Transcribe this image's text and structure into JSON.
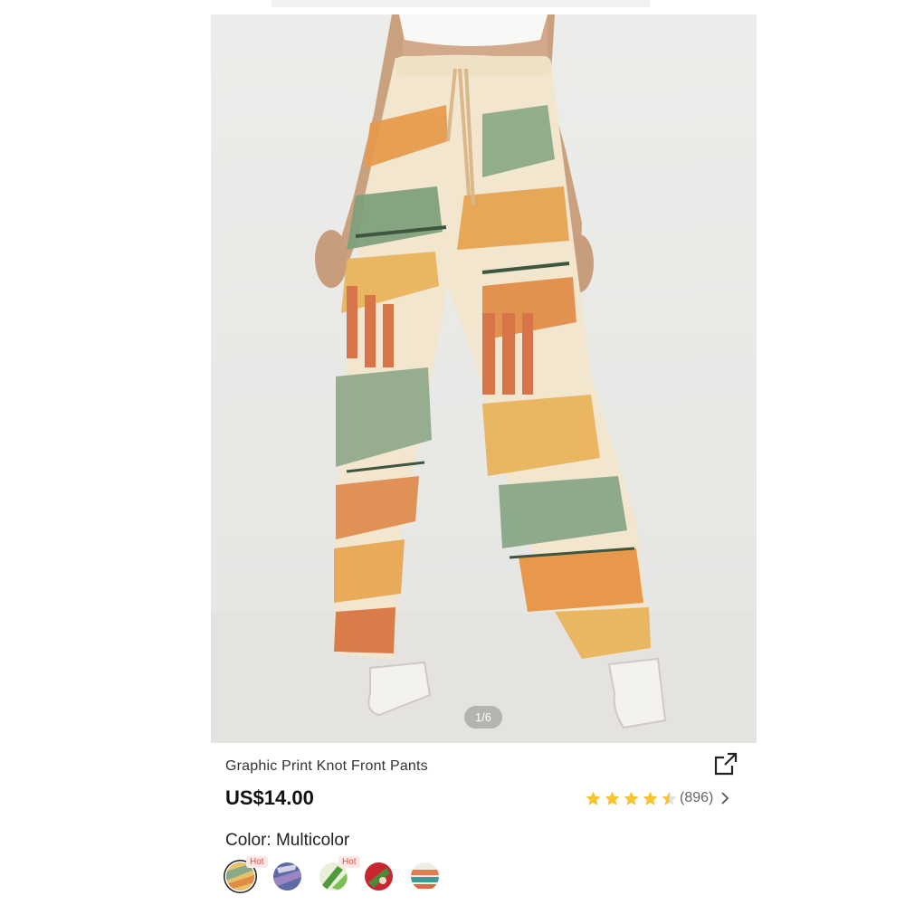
{
  "image": {
    "page_indicator": "1/6",
    "alt": "pants-photo"
  },
  "product": {
    "title": "Graphic Print Knot Front Pants",
    "price": "US$14.00",
    "rating_stars": 4.5,
    "review_count": "(896)"
  },
  "color": {
    "label": "Color: Multicolor",
    "swatches": [
      {
        "name": "multicolor-graphic",
        "hot": true,
        "selected": true
      },
      {
        "name": "blue-purple",
        "hot": false,
        "selected": false
      },
      {
        "name": "green-leaf",
        "hot": true,
        "selected": false
      },
      {
        "name": "red-green",
        "hot": false,
        "selected": false
      },
      {
        "name": "teal-orange",
        "hot": false,
        "selected": false
      }
    ],
    "hot_label": "Hot"
  },
  "icons": {
    "share": "share-icon",
    "star": "star-icon",
    "chevron": "chevron-right-icon"
  },
  "colors": {
    "star": "#f6c431",
    "hot_text": "#ef4b3a",
    "hot_bg": "#fde8e6"
  }
}
